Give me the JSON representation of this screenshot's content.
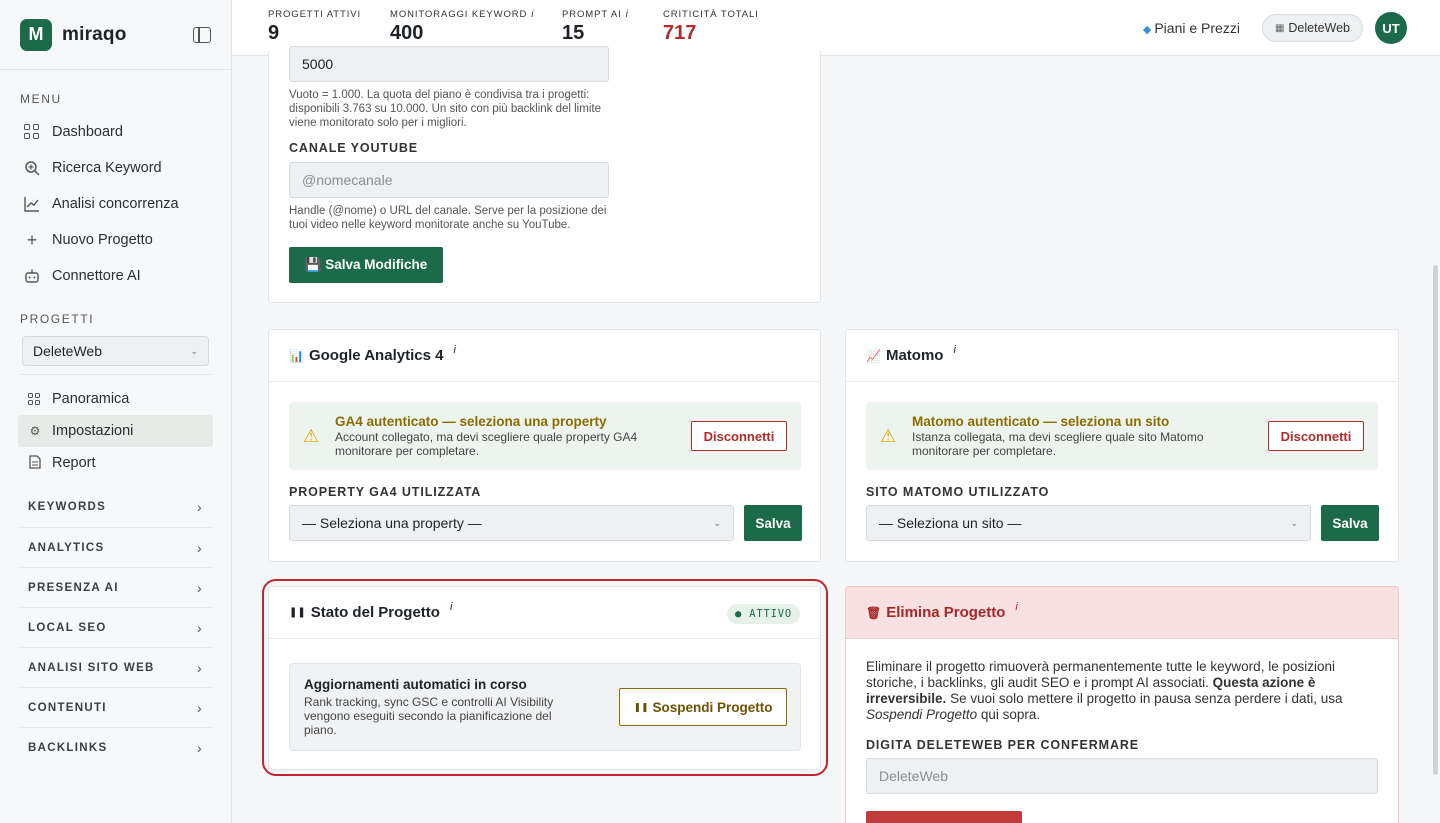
{
  "brand": {
    "logo_letter": "M",
    "name": "miraqo"
  },
  "sidebar": {
    "menu_title": "MENU",
    "menu": [
      {
        "label": "Dashboard"
      },
      {
        "label": "Ricerca Keyword"
      },
      {
        "label": "Analisi concorrenza"
      },
      {
        "label": "Nuovo Progetto"
      },
      {
        "label": "Connettore AI"
      }
    ],
    "projects_title": "PROGETTI",
    "project_select": "DeleteWeb",
    "project_nav": [
      {
        "label": "Panoramica"
      },
      {
        "label": "Impostazioni"
      },
      {
        "label": "Report"
      }
    ],
    "groups": [
      "KEYWORDS",
      "ANALYTICS",
      "PRESENZA AI",
      "LOCAL SEO",
      "ANALISI SITO WEB",
      "CONTENUTI",
      "BACKLINKS"
    ]
  },
  "topbar": {
    "stats": [
      {
        "label": "PROGETTI ATTIVI",
        "value": "9",
        "info": ""
      },
      {
        "label": "MONITORAGGI KEYWORD",
        "value": "400",
        "info": "i"
      },
      {
        "label": "PROMPT AI",
        "value": "15",
        "info": "i"
      },
      {
        "label": "CRITICITÀ TOTALI",
        "value": "717",
        "info": ""
      }
    ],
    "pricing": "Piani e Prezzi",
    "project_pill": "DeleteWeb",
    "avatar": "UT"
  },
  "settings_card": {
    "backlink_limit_value": "5000",
    "backlink_help": "Vuoto = 1.000. La quota del piano è condivisa tra i progetti: disponibili 3.763 su 10.000. Un sito con più backlink del limite viene monitorato solo per i migliori.",
    "youtube_label": "CANALE YOUTUBE",
    "youtube_placeholder": "@nomecanale",
    "youtube_help": "Handle (@nome) o URL del canale. Serve per la posizione dei tuoi video nelle keyword monitorate anche su YouTube.",
    "save_button": "💾 Salva Modifiche"
  },
  "ga4": {
    "title": "Google Analytics 4",
    "info": "i",
    "alert_title": "GA4 autenticato — seleziona una property",
    "alert_text": "Account collegato, ma devi scegliere quale property GA4 monitorare per completare.",
    "disconnect": "Disconnetti",
    "field_label": "PROPERTY GA4 UTILIZZATA",
    "select_value": "— Seleziona una property —",
    "save": "Salva"
  },
  "matomo": {
    "title": "Matomo",
    "info": "i",
    "alert_title": "Matomo autenticato — seleziona un sito",
    "alert_text": "Istanza collegata, ma devi scegliere quale sito Matomo monitorare per completare.",
    "disconnect": "Disconnetti",
    "field_label": "SITO MATOMO UTILIZZATO",
    "select_value": "— Seleziona un sito —",
    "save": "Salva"
  },
  "status_card": {
    "title": "Stato del Progetto",
    "info": "i",
    "badge": "● ATTIVO",
    "box_title": "Aggiornamenti automatici in corso",
    "box_text": "Rank tracking, sync GSC e controlli AI Visibility vengono eseguiti secondo la pianificazione del piano.",
    "suspend_button": "Sospendi Progetto"
  },
  "delete_card": {
    "title": "Elimina Progetto",
    "info": "i",
    "text_1": "Eliminare il progetto rimuoverà permanentemente tutte le keyword, le posizioni storiche, i backlinks, gli audit SEO e i prompt AI associati. ",
    "text_bold": "Questa azione è irreversibile.",
    "text_2": " Se vuoi solo mettere il progetto in pausa senza perdere i dati, usa ",
    "text_italic": "Sospendi Progetto",
    "text_3": " qui sopra.",
    "confirm_label": "DIGITA DELETEWEB PER CONFERMARE",
    "confirm_placeholder": "DeleteWeb"
  },
  "colors": {
    "brand_green": "#1b6b4a",
    "danger_red": "#b12b2b",
    "highlight_red": "#c0262f"
  }
}
